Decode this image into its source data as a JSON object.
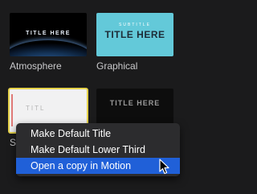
{
  "browser": {
    "items": [
      {
        "name": "Atmosphere",
        "thumb_title": "TITLE HERE"
      },
      {
        "name": "Graphical",
        "thumb_subtitle": "SUBTITLE",
        "thumb_title": "TITLE HERE"
      },
      {
        "name_visible_fragment": "S",
        "thumb_title": "TITL"
      },
      {
        "thumb_title": "TITLE HERE"
      }
    ]
  },
  "context_menu": {
    "items": [
      {
        "label": "Make Default Title"
      },
      {
        "label": "Make Default Lower Third"
      },
      {
        "label": "Open a copy in Motion",
        "highlighted": true
      }
    ]
  },
  "colors": {
    "background": "#1b1b1c",
    "selection_border": "#e5d24a",
    "menu_highlight": "#2060d8",
    "graphical_bg": "#63c9d9"
  },
  "icons": {
    "cursor": "arrow-pointer-icon"
  }
}
